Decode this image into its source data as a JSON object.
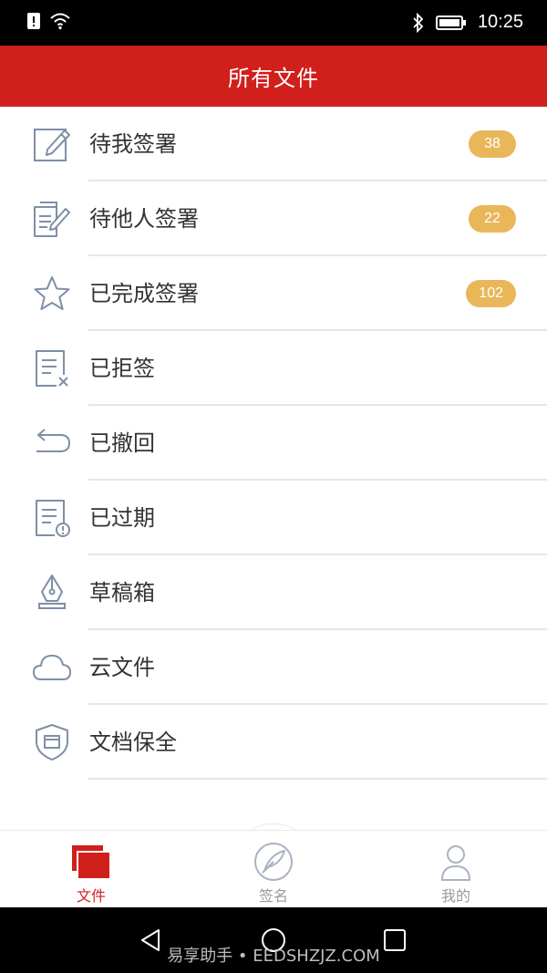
{
  "status_bar": {
    "time": "10:25"
  },
  "header": {
    "title": "所有文件"
  },
  "menu": [
    {
      "label": "待我签署",
      "badge": "38",
      "icon": "edit-document-icon"
    },
    {
      "label": "待他人签署",
      "badge": "22",
      "icon": "documents-sign-icon"
    },
    {
      "label": "已完成签署",
      "badge": "102",
      "icon": "star-icon"
    },
    {
      "label": "已拒签",
      "badge": "",
      "icon": "rejected-document-icon"
    },
    {
      "label": "已撤回",
      "badge": "",
      "icon": "undo-arrow-icon"
    },
    {
      "label": "已过期",
      "badge": "",
      "icon": "expired-document-icon"
    },
    {
      "label": "草稿箱",
      "badge": "",
      "icon": "pen-nib-icon"
    },
    {
      "label": "云文件",
      "badge": "",
      "icon": "cloud-icon"
    },
    {
      "label": "文档保全",
      "badge": "",
      "icon": "shield-document-icon"
    }
  ],
  "tabs": [
    {
      "label": "文件",
      "icon": "files-icon",
      "active": true
    },
    {
      "label": "签名",
      "icon": "quill-icon",
      "active": false
    },
    {
      "label": "我的",
      "icon": "user-icon",
      "active": false
    }
  ],
  "watermark": "易享助手 • EEDSHZJZ.COM",
  "colors": {
    "header": "#d11f1c",
    "badge": "#e9b75a",
    "icon": "#7f8fa6"
  }
}
